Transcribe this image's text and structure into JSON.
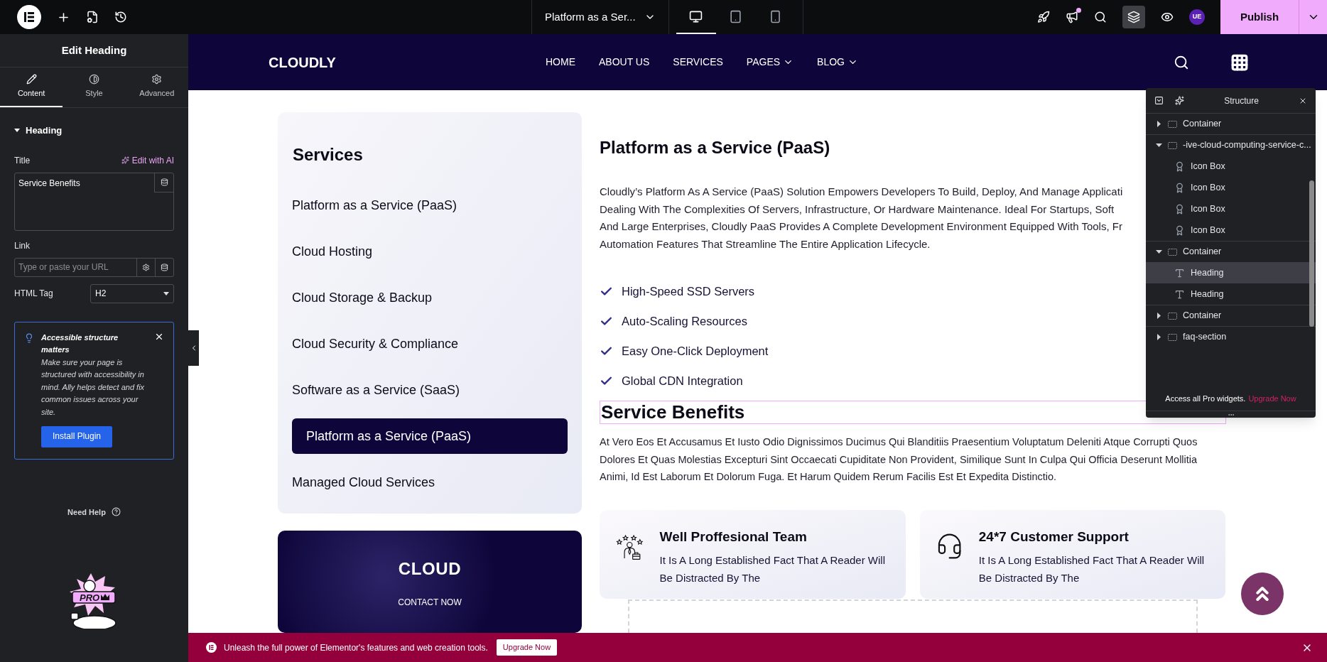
{
  "topbar": {
    "page_title": "Platform as a Ser...",
    "devices": [
      {
        "kind": "desktop",
        "selected": true
      },
      {
        "kind": "tablet",
        "selected": false
      },
      {
        "kind": "mobile",
        "selected": false
      }
    ],
    "notification_dot": true,
    "avatar": "UE",
    "publish": "Publish"
  },
  "panel": {
    "title": "Edit Heading",
    "tabs": [
      {
        "kind": "content",
        "label": "Content",
        "selected": true
      },
      {
        "kind": "style",
        "label": "Style",
        "selected": false
      },
      {
        "kind": "advanced",
        "label": "Advanced",
        "selected": false
      }
    ],
    "section": {
      "label": "Heading",
      "expanded": true
    },
    "title_label": "Title",
    "ai_link": "Edit with AI",
    "title_value": "Service Benefits",
    "link_label": "Link",
    "link_placeholder": "Type or paste your URL",
    "tag_label": "HTML Tag",
    "tag_value": "H2",
    "notice": {
      "title": "Accessible structure matters",
      "body": "Make sure your page is structured with accessibility in mind. Ally helps detect and fix common issues across your site.",
      "button": "Install Plugin"
    },
    "help": "Need Help",
    "promo_badge": "PRO"
  },
  "site": {
    "logo": "CLOUDLY",
    "nav": [
      {
        "label": "HOME",
        "dropdown": false
      },
      {
        "label": "ABOUT US",
        "dropdown": false
      },
      {
        "label": "SERVICES",
        "dropdown": false
      },
      {
        "label": "PAGES",
        "dropdown": true
      },
      {
        "label": "BLOG",
        "dropdown": true
      }
    ]
  },
  "services": {
    "title": "Services",
    "items": [
      {
        "label": "Platform as a Service (PaaS)",
        "selected": false
      },
      {
        "label": "Cloud Hosting",
        "selected": false
      },
      {
        "label": "Cloud Storage & Backup",
        "selected": false
      },
      {
        "label": "Cloud Security & Compliance",
        "selected": false
      },
      {
        "label": "Software as a Service (SaaS)",
        "selected": false
      },
      {
        "label": "Platform as a Service (PaaS)",
        "selected": true
      },
      {
        "label": "Managed Cloud Services",
        "selected": false
      }
    ]
  },
  "promo_card": {
    "title": "CLOUD",
    "link": "CONTACT NOW"
  },
  "article": {
    "heading": "Platform as a Service (PaaS)",
    "intro_lines": [
      "Cloudly’s Platform As A Service (PaaS) Solution Empowers Developers To Build, Deploy, And Manage Applicati",
      "Dealing With The Complexities Of Servers, Infrastructure, Or Hardware Maintenance. Ideal For Startups, Soft",
      "And Large Enterprises, Cloudly PaaS Provides A Complete Development Environment Equipped With Tools, Fr",
      "Automation Features That Streamline The Entire Application Lifecycle."
    ],
    "checklist": [
      "High-Speed SSD Servers",
      "Auto-Scaling Resources",
      "Easy One-Click Deployment",
      "Global CDN Integration"
    ],
    "benefits_heading": "Service Benefits",
    "benefits_text": "At Vero Eos Et Accusamus Et Iusto Odio Dignissimos Ducimus Qui Blanditiis Praesentium Voluptatum Deleniti Atque Corrupti Quos Dolores Et Quas Molestias Excepturi Sint Occaecati Cupiditate Non Provident, Similique Sunt In Culpa Qui Officia Deserunt Mollitia Animi, Id Est Laborum Et Dolorum Fuga. Et Harum Quidem Rerum Facilis Est Et Expedita Distinctio.",
    "features": [
      {
        "kind": "team",
        "title": "Well Proffesional Team",
        "text": "It Is A Long Established Fact That A Reader Will Be Distracted By The"
      },
      {
        "kind": "support",
        "title": "24*7 Customer Support",
        "text": "It Is A Long Established Fact That A Reader Will Be Distracted By The"
      }
    ]
  },
  "structure": {
    "title": "Structure",
    "tree": [
      {
        "kind": "container",
        "label": "Container",
        "expanded": false,
        "selected": false
      },
      {
        "kind": "container",
        "label": "-ive-cloud-computing-service-c...",
        "expanded": true,
        "selected": false,
        "children": [
          {
            "kind": "iconbox",
            "label": "Icon Box",
            "selected": false
          },
          {
            "kind": "iconbox",
            "label": "Icon Box",
            "selected": false
          },
          {
            "kind": "iconbox",
            "label": "Icon Box",
            "selected": false
          },
          {
            "kind": "iconbox",
            "label": "Icon Box",
            "selected": false
          }
        ]
      },
      {
        "kind": "container",
        "label": "Container",
        "expanded": true,
        "selected": false,
        "children": [
          {
            "kind": "heading",
            "label": "Heading",
            "selected": true
          },
          {
            "kind": "heading",
            "label": "Heading",
            "selected": false
          }
        ]
      },
      {
        "kind": "container",
        "label": "Container",
        "expanded": false,
        "selected": false
      },
      {
        "kind": "container",
        "label": "faq-section",
        "expanded": false,
        "selected": false
      }
    ],
    "footer_text": "Access all Pro widgets.",
    "footer_link": "Upgrade Now"
  },
  "banner": {
    "text": "Unleash the full power of Elementor's features and web creation tools.",
    "button": "Upgrade Now"
  }
}
